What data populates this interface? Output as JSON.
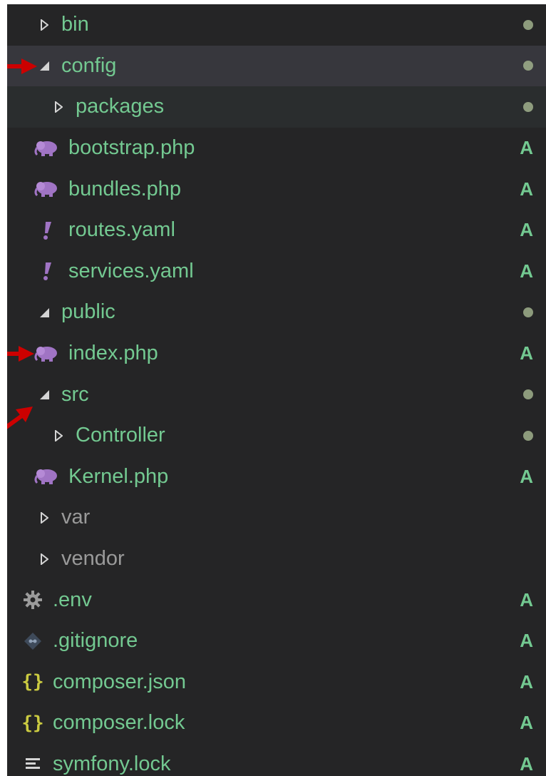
{
  "explorer": {
    "items": [
      {
        "label": "bin",
        "icon": "chevron-right-icon",
        "badge": ""
      },
      {
        "label": "config",
        "icon": "chevron-down-icon",
        "badge": ""
      },
      {
        "label": "packages",
        "icon": "chevron-right-icon",
        "badge": ""
      },
      {
        "label": "bootstrap.php",
        "icon": "php-elephant-icon",
        "badge": "A"
      },
      {
        "label": "bundles.php",
        "icon": "php-elephant-icon",
        "badge": "A"
      },
      {
        "label": "routes.yaml",
        "icon": "yaml-exclamation-icon",
        "badge": "A"
      },
      {
        "label": "services.yaml",
        "icon": "yaml-exclamation-icon",
        "badge": "A"
      },
      {
        "label": "public",
        "icon": "chevron-down-icon",
        "badge": ""
      },
      {
        "label": "index.php",
        "icon": "php-elephant-icon",
        "badge": "A"
      },
      {
        "label": "src",
        "icon": "chevron-down-icon",
        "badge": ""
      },
      {
        "label": "Controller",
        "icon": "chevron-right-icon",
        "badge": ""
      },
      {
        "label": "Kernel.php",
        "icon": "php-elephant-icon",
        "badge": "A"
      },
      {
        "label": "var",
        "icon": "chevron-right-icon",
        "badge": ""
      },
      {
        "label": "vendor",
        "icon": "chevron-right-icon",
        "badge": ""
      },
      {
        "label": ".env",
        "icon": "gear-icon",
        "badge": "A"
      },
      {
        "label": ".gitignore",
        "icon": "git-diamond-icon",
        "badge": "A"
      },
      {
        "label": "composer.json",
        "icon": "json-braces-icon",
        "badge": "A"
      },
      {
        "label": "composer.lock",
        "icon": "json-braces-icon",
        "badge": "A"
      },
      {
        "label": "symfony.lock",
        "icon": "lines-icon",
        "badge": "A"
      }
    ]
  },
  "colors": {
    "background": "#252526",
    "git_added": "#73c991",
    "php_icon": "#a074c4",
    "yaml_icon": "#a074c4",
    "json_icon": "#cbcb41",
    "annotation_arrow": "#cc0000"
  }
}
